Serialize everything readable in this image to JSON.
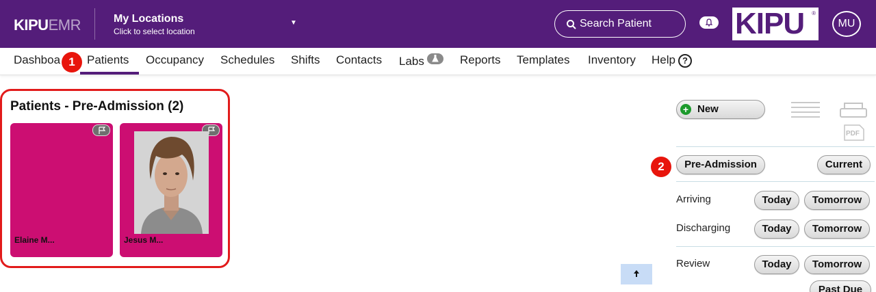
{
  "header": {
    "brand_bold": "KIPU",
    "brand_light": "EMR",
    "location_title": "My Locations",
    "location_sub": "Click to select location",
    "search_label": "Search Patient",
    "logo_text": "KIPU",
    "logo_mark": "®",
    "avatar_initials": "MU"
  },
  "nav": {
    "items": [
      "Dashboa",
      "Patients",
      "Occupancy",
      "Schedules",
      "Shifts",
      "Contacts",
      "Labs",
      "Reports",
      "Templates",
      "Inventory",
      "Help"
    ],
    "active": "Patients",
    "help_icon_text": "?"
  },
  "markers": {
    "one": "1",
    "two": "2"
  },
  "patients": {
    "title": "Patients - Pre-Admission (2)",
    "cards": [
      {
        "name": "Elaine M...",
        "has_photo": false
      },
      {
        "name": "Jesus M...",
        "has_photo": true
      }
    ]
  },
  "actions": {
    "new_label": "New",
    "new_icon": "+",
    "pdf_label": "PDF",
    "pre_admission": "Pre-Admission",
    "current": "Current",
    "arriving": "Arriving",
    "discharging": "Discharging",
    "review": "Review",
    "today": "Today",
    "tomorrow": "Tomorrow",
    "past_due": "Past Due"
  },
  "colors": {
    "header_bg": "#541d7a",
    "card_bg": "#cc0e72",
    "marker": "#e8150c",
    "highlight_border": "#e21b1b"
  }
}
